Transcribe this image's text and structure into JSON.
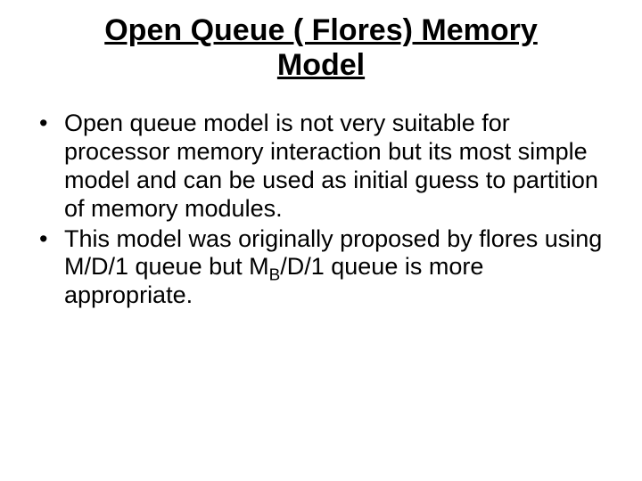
{
  "title": "Open Queue ( Flores) Memory Model",
  "bullets": {
    "b1": "Open queue model is not very suitable for processor memory interaction but its most simple model and can be used as initial guess to partition of memory modules.",
    "b2_a": "This model was originally proposed by flores using M/D/1 queue but M",
    "b2_sub": "B",
    "b2_b": "/D/1 queue is more appropriate."
  }
}
